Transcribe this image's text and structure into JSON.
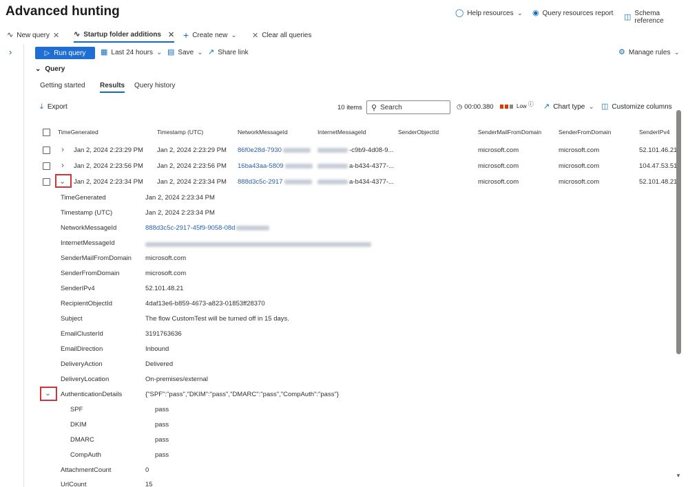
{
  "app": {
    "title": "Advanced hunting"
  },
  "top_links": {
    "help": "Help resources",
    "report": "Query resources report",
    "schema": "Schema reference"
  },
  "tabs": [
    {
      "label": "New query"
    },
    {
      "label": "Startup folder additions"
    }
  ],
  "tab_actions": {
    "create_new": "Create new",
    "clear_all": "Clear all queries"
  },
  "toolbar": {
    "run": "Run query",
    "time_range": "Last 24 hours",
    "save": "Save",
    "share": "Share link",
    "manage_rules": "Manage rules"
  },
  "query_section": {
    "label": "Query"
  },
  "sub_tabs": [
    "Getting started",
    "Results",
    "Query history"
  ],
  "results_bar": {
    "export": "Export",
    "item_count": "10 items",
    "search_placeholder": "Search",
    "duration": "00:00.380",
    "usage": "Low",
    "chart_type": "Chart type",
    "customize": "Customize columns"
  },
  "columns": [
    "TimeGenerated",
    "Timestamp (UTC)",
    "NetworkMessageId",
    "InternetMessageId",
    "SenderObjectId",
    "SenderMailFromDomain",
    "SenderFromDomain",
    "SenderIPv4"
  ],
  "rows": [
    {
      "time_generated": "Jan 2, 2024 2:23:29 PM",
      "timestamp": "Jan 2, 2024 2:23:29 PM",
      "network_id": "86f0e28d-7930",
      "internet_id": "-c9b9-4d08-9...",
      "sender_object_id": "",
      "mail_from": "microsoft.com",
      "from_domain": "microsoft.com",
      "ipv4": "52.101.46.21"
    },
    {
      "time_generated": "Jan 2, 2024 2:23:56 PM",
      "timestamp": "Jan 2, 2024 2:23:56 PM",
      "network_id": "16ba43aa-5809",
      "internet_id": "a-b434-4377-...",
      "sender_object_id": "",
      "mail_from": "microsoft.com",
      "from_domain": "microsoft.com",
      "ipv4": "104.47.53.51"
    },
    {
      "time_generated": "Jan 2, 2024 2:23:34 PM",
      "timestamp": "Jan 2, 2024 2:23:34 PM",
      "network_id": "888d3c5c-2917",
      "internet_id": "a-b434-4377-...",
      "sender_object_id": "",
      "mail_from": "microsoft.com",
      "from_domain": "microsoft.com",
      "ipv4": "52.101.48.21"
    }
  ],
  "details": [
    {
      "key": "TimeGenerated",
      "value": "Jan 2, 2024 2:23:34 PM"
    },
    {
      "key": "Timestamp (UTC)",
      "value": "Jan 2, 2024 2:23:34 PM"
    },
    {
      "key": "NetworkMessageId",
      "value": "888d3c5c-2917-45f9-9058-08d"
    },
    {
      "key": "InternetMessageId",
      "value": ""
    },
    {
      "key": "SenderMailFromDomain",
      "value": "microsoft.com"
    },
    {
      "key": "SenderFromDomain",
      "value": "microsoft.com"
    },
    {
      "key": "SenderIPv4",
      "value": "52.101.48.21"
    },
    {
      "key": "RecipientObjectId",
      "value": "4daf13e6-b859-4673-a823-01853ff28370"
    },
    {
      "key": "Subject",
      "value": "The flow CustomTest will be turned off in 15 days."
    },
    {
      "key": "EmailClusterId",
      "value": "3191763636"
    },
    {
      "key": "EmailDirection",
      "value": "Inbound"
    },
    {
      "key": "DeliveryAction",
      "value": "Delivered"
    },
    {
      "key": "DeliveryLocation",
      "value": "On-premises/external"
    },
    {
      "key": "AuthenticationDetails",
      "value": "{\"SPF\":\"pass\",\"DKIM\":\"pass\",\"DMARC\":\"pass\",\"CompAuth\":\"pass\"}"
    }
  ],
  "auth_sub": [
    {
      "key": "SPF",
      "value": "pass"
    },
    {
      "key": "DKIM",
      "value": "pass"
    },
    {
      "key": "DMARC",
      "value": "pass"
    },
    {
      "key": "CompAuth",
      "value": "pass"
    }
  ],
  "details_after": [
    {
      "key": "AttachmentCount",
      "value": "0"
    },
    {
      "key": "UrlCount",
      "value": "15"
    }
  ],
  "colors": {
    "accent": "#0f6cbd",
    "run_button": "#1f6ed4",
    "highlight_box": "#d13438",
    "link": "#2a5ea8",
    "usage_low": "#d83b01"
  },
  "icons": [
    "help-icon",
    "report-icon",
    "schema-icon",
    "query-icon",
    "close-icon",
    "plus-icon",
    "play-icon",
    "calendar-icon",
    "save-icon",
    "share-icon",
    "settings-icon",
    "download-icon",
    "search-icon",
    "clock-icon",
    "chart-icon",
    "columns-icon",
    "chevron-down-icon",
    "chevron-right-icon"
  ]
}
